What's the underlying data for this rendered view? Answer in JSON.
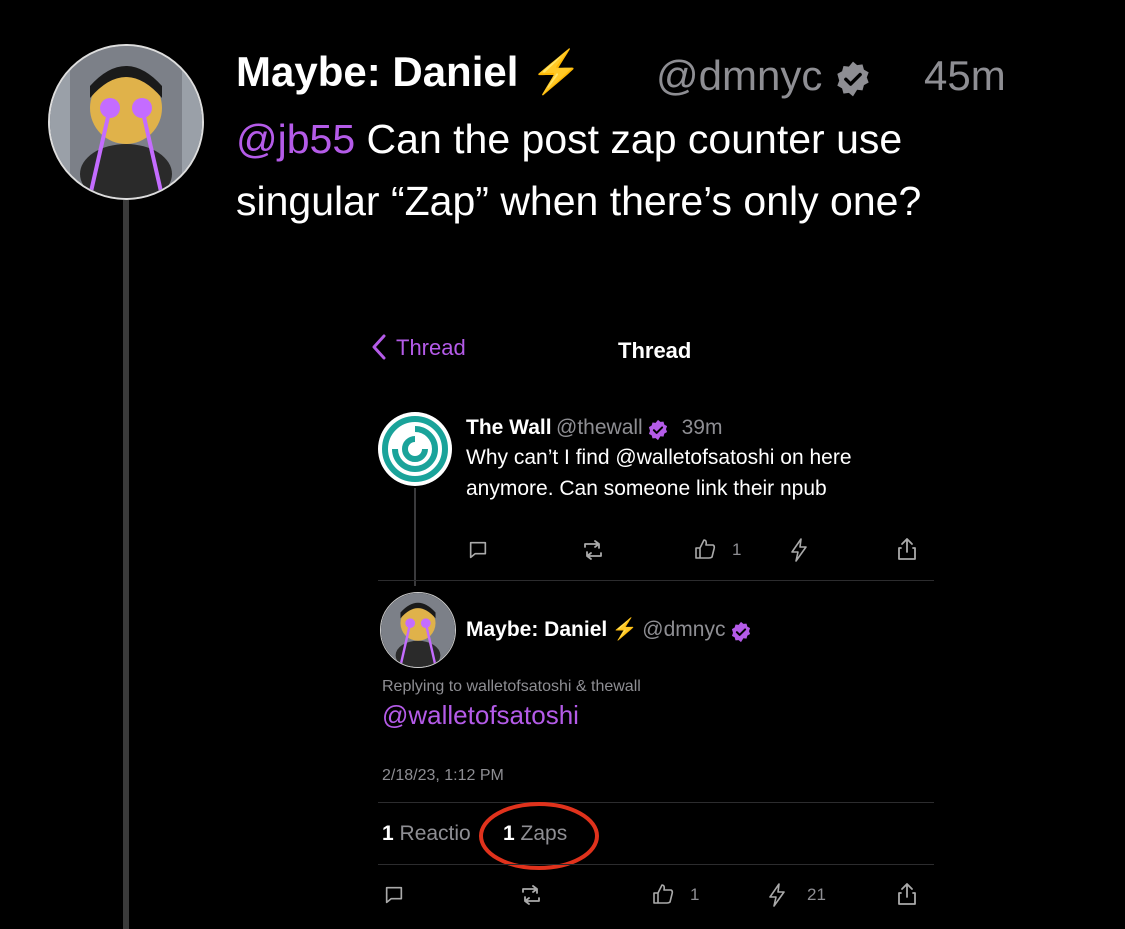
{
  "outer_post": {
    "display_name": "Maybe: Daniel",
    "lightning": "⚡️",
    "handle": "@dmnyc",
    "time": "45m",
    "mention": "@jb55",
    "body_line1": "Can the post zap counter use",
    "body_line2": "singular “Zap” when there’s only one?"
  },
  "inner": {
    "nav_back_label": "Thread",
    "nav_title": "Thread",
    "post1": {
      "display_name": "The Wall",
      "handle": "@thewall",
      "time": "39m",
      "body_line1": "Why can’t I find @walletofsatoshi on here",
      "body_line2": "anymore. Can someone link their npub",
      "like_count": "1"
    },
    "post2": {
      "display_name": "Maybe: Daniel",
      "lightning": "⚡️",
      "handle": "@dmnyc",
      "replying_to": "Replying to walletofsatoshi & thewall",
      "mention": "@walletofsatoshi",
      "timestamp": "2/18/23, 1:12 PM",
      "reactions_count": "1",
      "reactions_label": "Reactio",
      "zaps_count": "1",
      "zaps_label": "Zaps",
      "like_count": "1",
      "zap_amount": "21"
    }
  },
  "colors": {
    "accent": "#b45be8",
    "annotation_circle": "#e0321c",
    "muted": "#8e8e93"
  }
}
